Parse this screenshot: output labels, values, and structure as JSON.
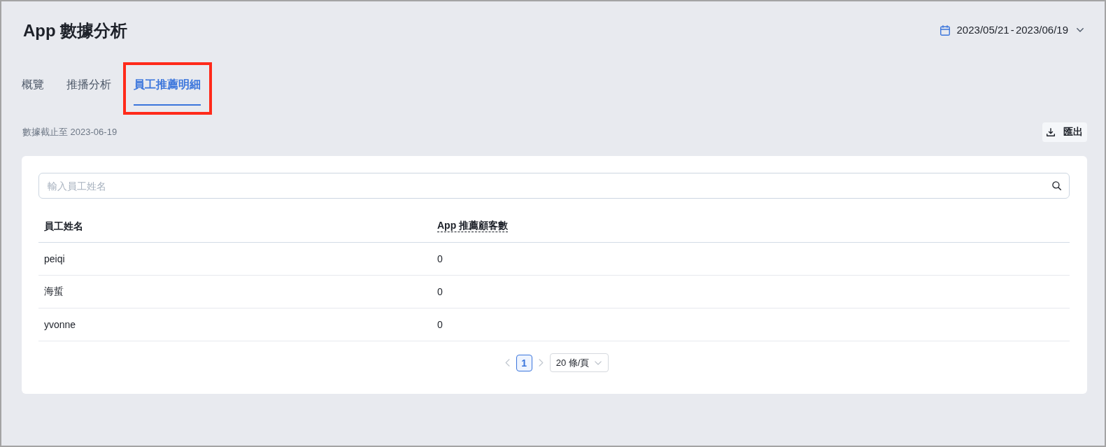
{
  "page": {
    "title": "App 數據分析",
    "date_range": "2023/05/21 - 2023/06/19"
  },
  "tabs": [
    {
      "label": "概覽",
      "selected": false,
      "highlighted": false
    },
    {
      "label": "推播分析",
      "selected": false,
      "highlighted": false
    },
    {
      "label": "員工推薦明細",
      "selected": true,
      "highlighted": true
    }
  ],
  "toolbar": {
    "data_cutoff": "數據截止至 2023-06-19",
    "export_button": "匯出"
  },
  "search": {
    "placeholder": "輸入員工姓名"
  },
  "table": {
    "columns": [
      {
        "label": "員工姓名",
        "has_tooltip": false
      },
      {
        "label": "App 推薦顧客數",
        "has_tooltip": true
      }
    ],
    "rows": [
      [
        "peiqi",
        "0"
      ],
      [
        "海蜇",
        "0"
      ],
      [
        "yvonne",
        "0"
      ]
    ]
  },
  "pagination": {
    "prev_disabled": true,
    "pages": [
      {
        "label": "1",
        "selected": true
      }
    ],
    "next_disabled": true,
    "page_size": "20 條/頁"
  }
}
